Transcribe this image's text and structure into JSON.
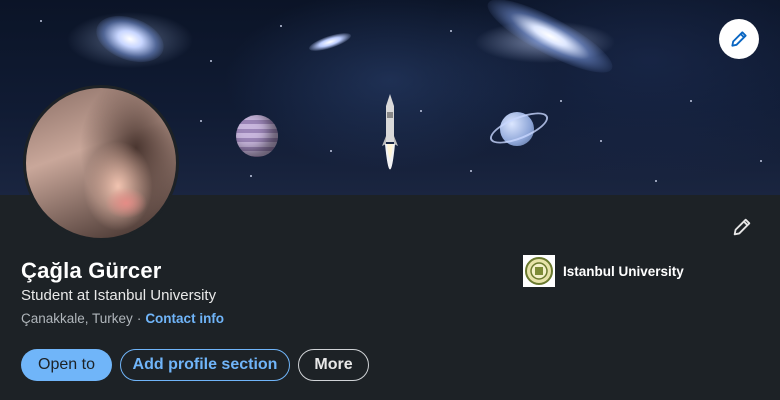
{
  "banner": {
    "edit_icon": "pencil-icon",
    "theme": "space-rocket-launch"
  },
  "profile": {
    "name": "Çağla Gürcer",
    "headline": "Student at Istanbul University",
    "location": "Çanakkale, Turkey",
    "separator": "·",
    "contact_label": "Contact info",
    "edit_icon": "pencil-icon"
  },
  "education": {
    "school_name": "Istanbul University",
    "logo_icon": "university-seal-icon"
  },
  "actions": {
    "open_to_label": "Open to",
    "add_section_label": "Add profile section",
    "more_label": "More"
  },
  "colors": {
    "accent": "#70b5f9",
    "background": "#1d2226",
    "text_primary": "#ffffff",
    "text_secondary": "#b0b6bb"
  }
}
